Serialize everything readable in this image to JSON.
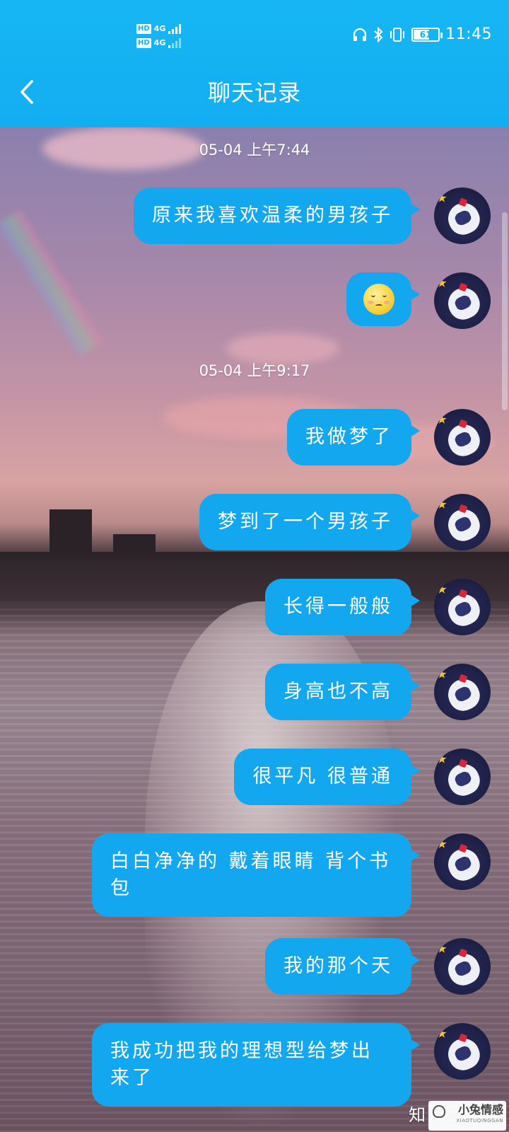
{
  "status_bar": {
    "net_top": "HD",
    "net_bottom": "HD",
    "gen_top": "4G",
    "gen_bottom": "4G",
    "battery": "61",
    "time": "11:45"
  },
  "header": {
    "title": "聊天记录"
  },
  "messages": [
    {
      "timestamp": "05-04 上午7:44"
    },
    {
      "text": "原来我喜欢温柔的男孩子"
    },
    {
      "emoji": "blush-smile-emoji"
    },
    {
      "timestamp": "05-04 上午9:17"
    },
    {
      "text": "我做梦了"
    },
    {
      "text": "梦到了一个男孩子"
    },
    {
      "text": "长得一般般"
    },
    {
      "text": "身高也不高"
    },
    {
      "text": "很平凡 很普通"
    },
    {
      "text": "白白净净的 戴着眼睛 背个书包"
    },
    {
      "text": "我的那个天"
    },
    {
      "text": "我成功把我的理想型给梦出来了"
    }
  ],
  "watermark": {
    "zhi": "知",
    "brand": "小兔情感",
    "pinyin": "XIAOTUQINGGAN"
  },
  "colors": {
    "header": "#13aef2",
    "bubble": "#12a7ef"
  }
}
